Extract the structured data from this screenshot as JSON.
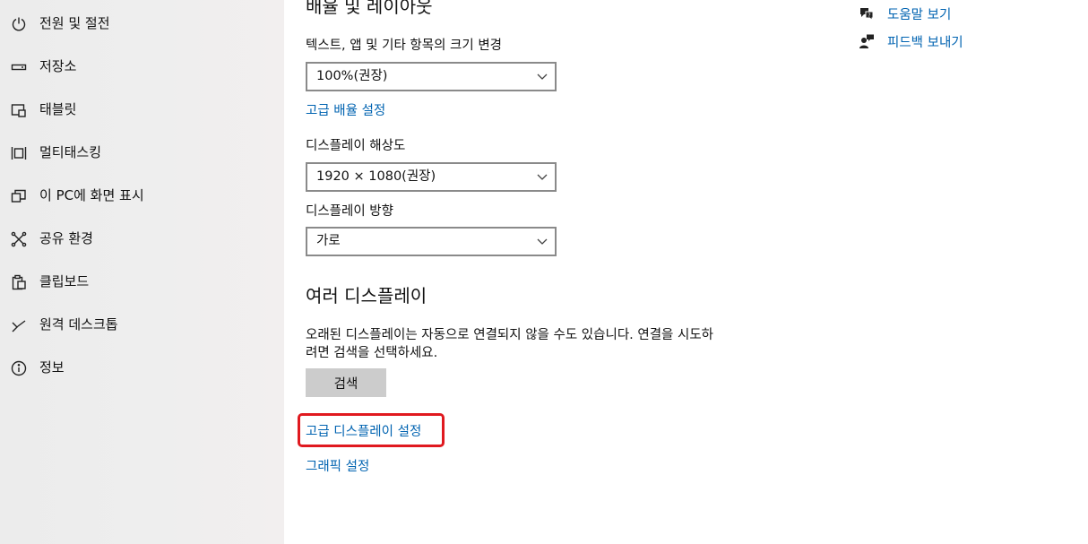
{
  "sidebar": {
    "items": [
      {
        "label": "전원 및 절전",
        "icon": "power-icon"
      },
      {
        "label": "저장소",
        "icon": "storage-icon"
      },
      {
        "label": "태블릿",
        "icon": "tablet-icon"
      },
      {
        "label": "멀티태스킹",
        "icon": "multitasking-icon"
      },
      {
        "label": "이 PC에 화면 표시",
        "icon": "project-icon"
      },
      {
        "label": "공유 환경",
        "icon": "shared-experiences-icon"
      },
      {
        "label": "클립보드",
        "icon": "clipboard-icon"
      },
      {
        "label": "원격 데스크톱",
        "icon": "remote-desktop-icon"
      },
      {
        "label": "정보",
        "icon": "info-icon"
      }
    ]
  },
  "main": {
    "scale_section_title": "배율 및 레이아웃",
    "text_size_label": "텍스트, 앱 및 기타 항목의 크기 변경",
    "text_size_value": "100%(권장)",
    "advanced_scaling_link": "고급 배율 설정",
    "resolution_label": "디스플레이 해상도",
    "resolution_value": "1920 × 1080(권장)",
    "orientation_label": "디스플레이 방향",
    "orientation_value": "가로",
    "multi_display_title": "여러 디스플레이",
    "multi_display_desc": "오래된 디스플레이는 자동으로 연결되지 않을 수도 있습니다. 연결을 시도하려면 검색을 선택하세요.",
    "detect_button": "검색",
    "advanced_display_link": "고급 디스플레이 설정",
    "graphics_link": "그래픽 설정"
  },
  "related": {
    "help_link": "도움말 보기",
    "feedback_link": "피드백 보내기"
  },
  "colors": {
    "link": "#0063b1",
    "highlight": "#e0191f",
    "button_bg": "#cccccc"
  }
}
